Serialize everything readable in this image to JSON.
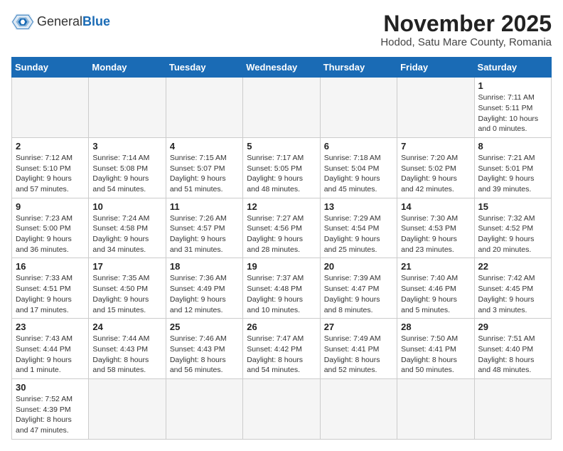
{
  "header": {
    "logo_general": "General",
    "logo_blue": "Blue",
    "month_year": "November 2025",
    "location": "Hodod, Satu Mare County, Romania"
  },
  "weekdays": [
    "Sunday",
    "Monday",
    "Tuesday",
    "Wednesday",
    "Thursday",
    "Friday",
    "Saturday"
  ],
  "weeks": [
    [
      {
        "day": "",
        "info": ""
      },
      {
        "day": "",
        "info": ""
      },
      {
        "day": "",
        "info": ""
      },
      {
        "day": "",
        "info": ""
      },
      {
        "day": "",
        "info": ""
      },
      {
        "day": "",
        "info": ""
      },
      {
        "day": "1",
        "info": "Sunrise: 7:11 AM\nSunset: 5:11 PM\nDaylight: 10 hours and 0 minutes."
      }
    ],
    [
      {
        "day": "2",
        "info": "Sunrise: 7:12 AM\nSunset: 5:10 PM\nDaylight: 9 hours and 57 minutes."
      },
      {
        "day": "3",
        "info": "Sunrise: 7:14 AM\nSunset: 5:08 PM\nDaylight: 9 hours and 54 minutes."
      },
      {
        "day": "4",
        "info": "Sunrise: 7:15 AM\nSunset: 5:07 PM\nDaylight: 9 hours and 51 minutes."
      },
      {
        "day": "5",
        "info": "Sunrise: 7:17 AM\nSunset: 5:05 PM\nDaylight: 9 hours and 48 minutes."
      },
      {
        "day": "6",
        "info": "Sunrise: 7:18 AM\nSunset: 5:04 PM\nDaylight: 9 hours and 45 minutes."
      },
      {
        "day": "7",
        "info": "Sunrise: 7:20 AM\nSunset: 5:02 PM\nDaylight: 9 hours and 42 minutes."
      },
      {
        "day": "8",
        "info": "Sunrise: 7:21 AM\nSunset: 5:01 PM\nDaylight: 9 hours and 39 minutes."
      }
    ],
    [
      {
        "day": "9",
        "info": "Sunrise: 7:23 AM\nSunset: 5:00 PM\nDaylight: 9 hours and 36 minutes."
      },
      {
        "day": "10",
        "info": "Sunrise: 7:24 AM\nSunset: 4:58 PM\nDaylight: 9 hours and 34 minutes."
      },
      {
        "day": "11",
        "info": "Sunrise: 7:26 AM\nSunset: 4:57 PM\nDaylight: 9 hours and 31 minutes."
      },
      {
        "day": "12",
        "info": "Sunrise: 7:27 AM\nSunset: 4:56 PM\nDaylight: 9 hours and 28 minutes."
      },
      {
        "day": "13",
        "info": "Sunrise: 7:29 AM\nSunset: 4:54 PM\nDaylight: 9 hours and 25 minutes."
      },
      {
        "day": "14",
        "info": "Sunrise: 7:30 AM\nSunset: 4:53 PM\nDaylight: 9 hours and 23 minutes."
      },
      {
        "day": "15",
        "info": "Sunrise: 7:32 AM\nSunset: 4:52 PM\nDaylight: 9 hours and 20 minutes."
      }
    ],
    [
      {
        "day": "16",
        "info": "Sunrise: 7:33 AM\nSunset: 4:51 PM\nDaylight: 9 hours and 17 minutes."
      },
      {
        "day": "17",
        "info": "Sunrise: 7:35 AM\nSunset: 4:50 PM\nDaylight: 9 hours and 15 minutes."
      },
      {
        "day": "18",
        "info": "Sunrise: 7:36 AM\nSunset: 4:49 PM\nDaylight: 9 hours and 12 minutes."
      },
      {
        "day": "19",
        "info": "Sunrise: 7:37 AM\nSunset: 4:48 PM\nDaylight: 9 hours and 10 minutes."
      },
      {
        "day": "20",
        "info": "Sunrise: 7:39 AM\nSunset: 4:47 PM\nDaylight: 9 hours and 8 minutes."
      },
      {
        "day": "21",
        "info": "Sunrise: 7:40 AM\nSunset: 4:46 PM\nDaylight: 9 hours and 5 minutes."
      },
      {
        "day": "22",
        "info": "Sunrise: 7:42 AM\nSunset: 4:45 PM\nDaylight: 9 hours and 3 minutes."
      }
    ],
    [
      {
        "day": "23",
        "info": "Sunrise: 7:43 AM\nSunset: 4:44 PM\nDaylight: 9 hours and 1 minute."
      },
      {
        "day": "24",
        "info": "Sunrise: 7:44 AM\nSunset: 4:43 PM\nDaylight: 8 hours and 58 minutes."
      },
      {
        "day": "25",
        "info": "Sunrise: 7:46 AM\nSunset: 4:43 PM\nDaylight: 8 hours and 56 minutes."
      },
      {
        "day": "26",
        "info": "Sunrise: 7:47 AM\nSunset: 4:42 PM\nDaylight: 8 hours and 54 minutes."
      },
      {
        "day": "27",
        "info": "Sunrise: 7:49 AM\nSunset: 4:41 PM\nDaylight: 8 hours and 52 minutes."
      },
      {
        "day": "28",
        "info": "Sunrise: 7:50 AM\nSunset: 4:41 PM\nDaylight: 8 hours and 50 minutes."
      },
      {
        "day": "29",
        "info": "Sunrise: 7:51 AM\nSunset: 4:40 PM\nDaylight: 8 hours and 48 minutes."
      }
    ],
    [
      {
        "day": "30",
        "info": "Sunrise: 7:52 AM\nSunset: 4:39 PM\nDaylight: 8 hours and 47 minutes."
      },
      {
        "day": "",
        "info": ""
      },
      {
        "day": "",
        "info": ""
      },
      {
        "day": "",
        "info": ""
      },
      {
        "day": "",
        "info": ""
      },
      {
        "day": "",
        "info": ""
      },
      {
        "day": "",
        "info": ""
      }
    ]
  ]
}
